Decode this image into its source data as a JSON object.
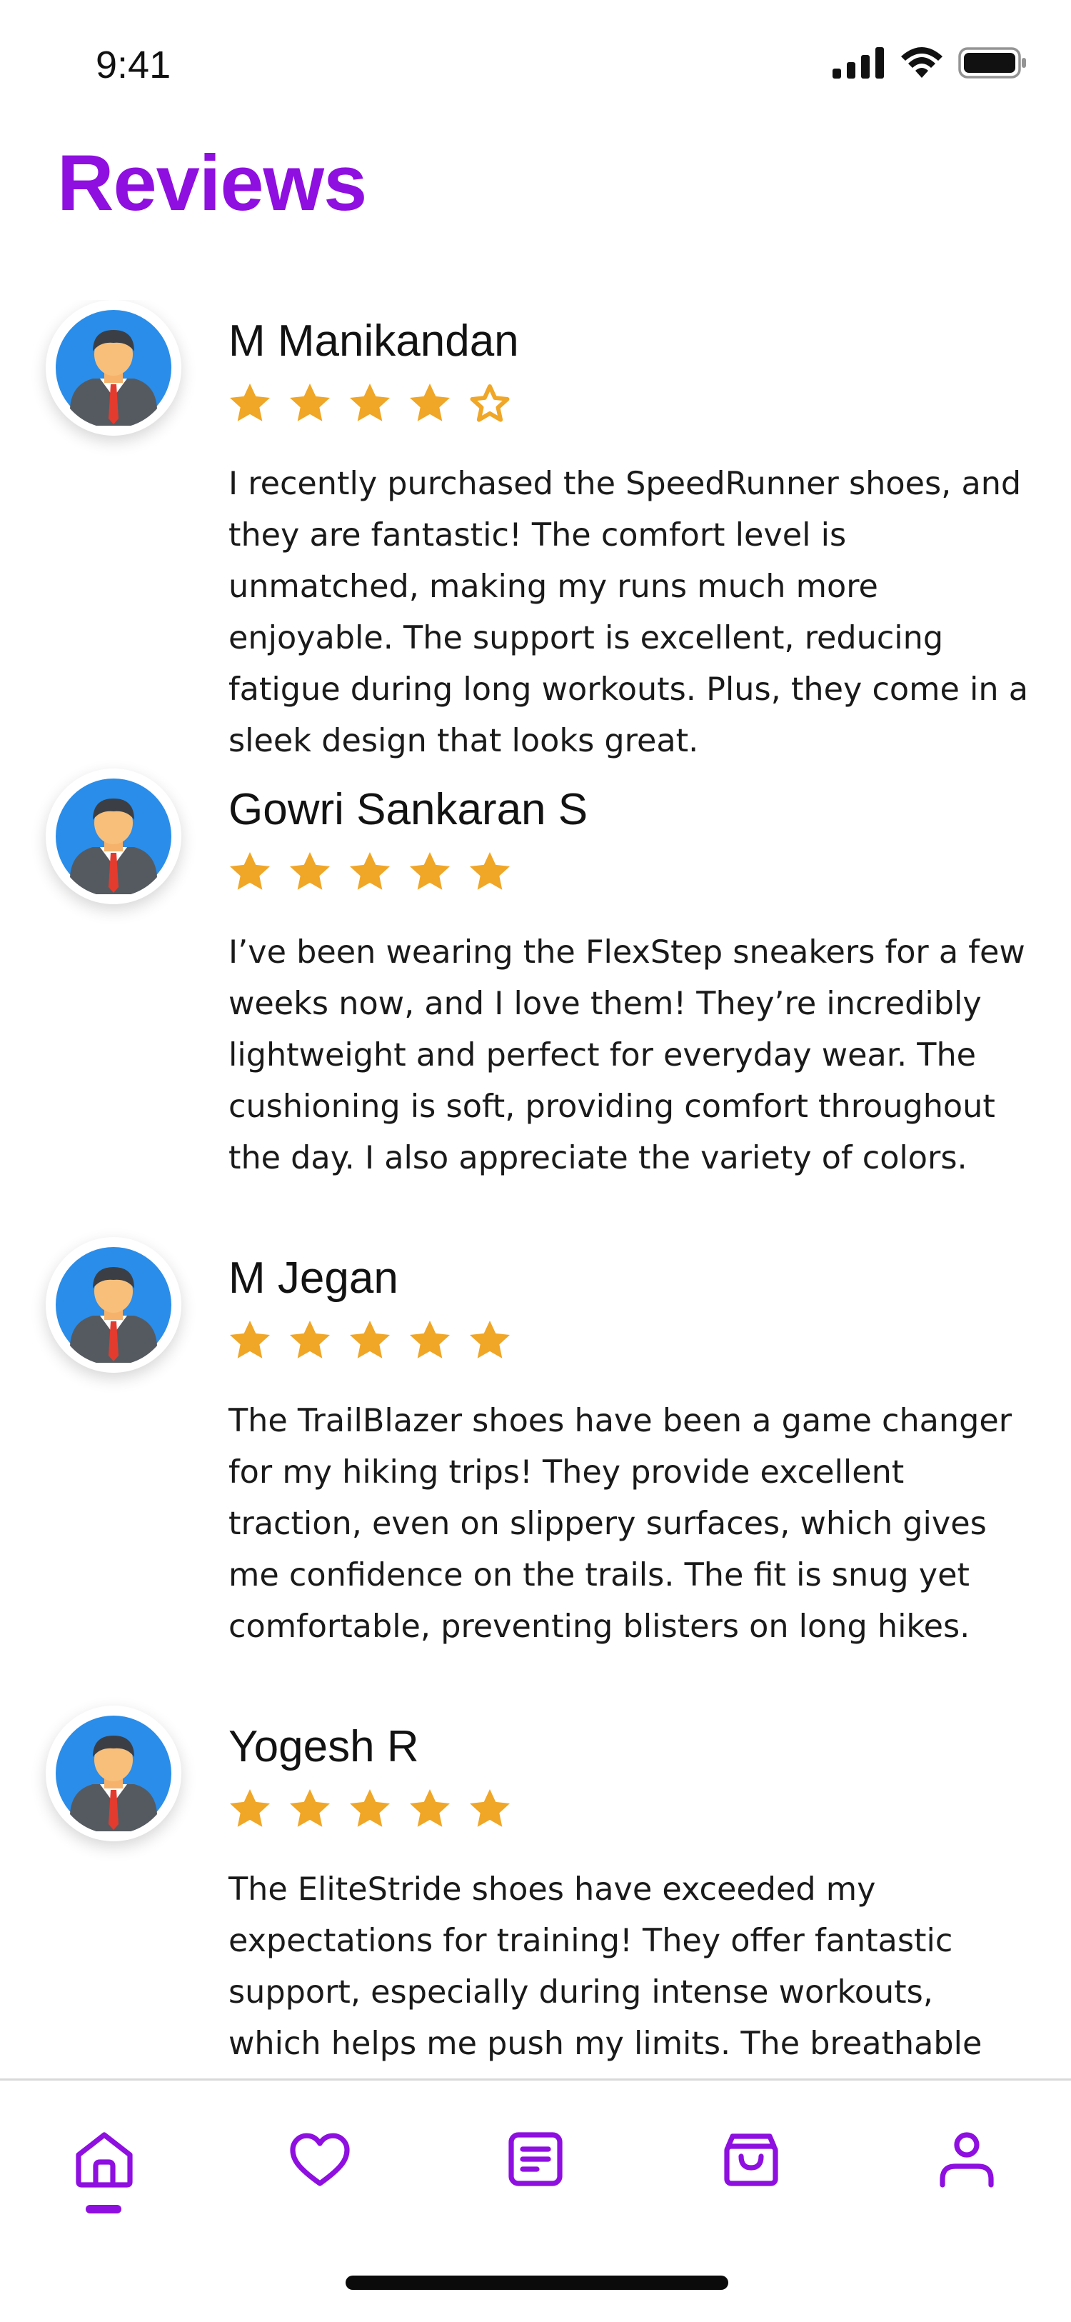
{
  "status_bar": {
    "time": "9:41",
    "icons": [
      "cellular-signal-icon",
      "wifi-icon",
      "battery-icon"
    ]
  },
  "page": {
    "title": "Reviews",
    "accent_color": "#8e0fe0",
    "star_color": "#f0a626"
  },
  "reviews": [
    {
      "name": "M Manikandan",
      "rating": 4.5,
      "text": "I recently purchased the SpeedRunner shoes, and they are fantastic! The comfort level is unmatched, making my runs much more enjoyable. The support is excellent, reducing fatigue during long workouts. Plus, they come in a sleek design that looks great."
    },
    {
      "name": "Gowri Sankaran S",
      "rating": 5,
      "text": "I’ve been wearing the FlexStep sneakers for a few weeks now, and I love them! They’re incredibly lightweight and perfect for everyday wear. The cushioning is soft, providing comfort throughout the day. I also appreciate the variety of colors."
    },
    {
      "name": "M Jegan",
      "rating": 5,
      "text": "The TrailBlazer shoes have been a game changer for my hiking trips! They provide excellent traction, even on slippery surfaces, which gives me confidence on the trails. The fit is snug yet comfortable, preventing blisters on long hikes."
    },
    {
      "name": "Yogesh R",
      "rating": 5,
      "text": "The EliteStride shoes have exceeded my expectations for training! They offer fantastic support, especially during intense workouts, which helps me push my limits. The breathable material"
    }
  ],
  "bottom_nav": {
    "items": [
      {
        "icon": "home-icon",
        "active": true
      },
      {
        "icon": "heart-icon",
        "active": false
      },
      {
        "icon": "document-icon",
        "active": false
      },
      {
        "icon": "shopping-bag-icon",
        "active": false
      },
      {
        "icon": "profile-icon",
        "active": false
      }
    ]
  }
}
